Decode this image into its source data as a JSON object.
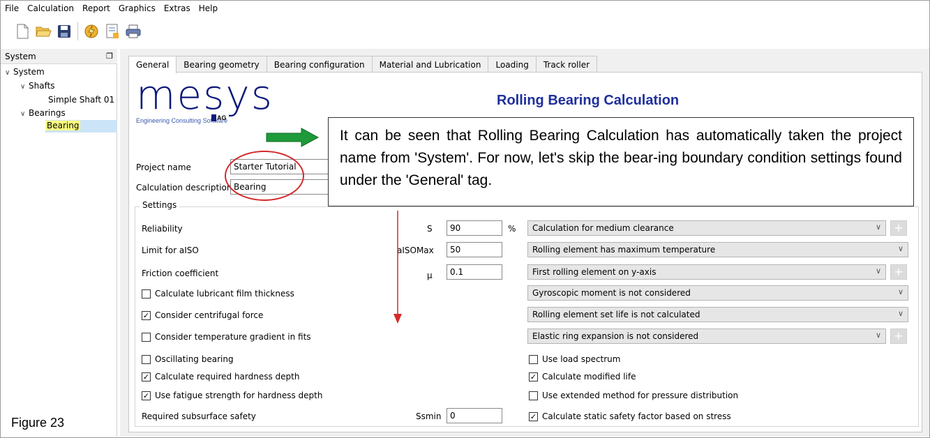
{
  "menu": [
    "File",
    "Calculation",
    "Report",
    "Graphics",
    "Extras",
    "Help"
  ],
  "toolbar": {
    "icons": [
      "new-file-icon",
      "open-folder-icon",
      "save-icon",
      "calculate-icon",
      "report-icon",
      "print-icon"
    ]
  },
  "left_panel": {
    "title": "System",
    "tree": {
      "root": "System",
      "shafts": "Shafts",
      "shaft_item": "Simple Shaft 01",
      "bearings": "Bearings",
      "bearing_item": "Bearing"
    }
  },
  "figure_label": "Figure 23",
  "tabs": [
    "General",
    "Bearing geometry",
    "Bearing configuration",
    "Material and Lubrication",
    "Loading",
    "Track roller"
  ],
  "logo": {
    "main": "mesys",
    "sub": "Engineering Consulting Software",
    "ag": "AG"
  },
  "calc_title": "Rolling Bearing Calculation",
  "project": {
    "name_label": "Project name",
    "name_value": "Starter Tutorial",
    "desc_label": "Calculation description",
    "desc_value": "Bearing"
  },
  "settings": {
    "legend": "Settings",
    "reliability": {
      "label": "Reliability",
      "symbol": "S",
      "value": "90",
      "unit": "%"
    },
    "limit_aiso": {
      "label": "Limit for aISO",
      "symbol": "aISOMax",
      "value": "50"
    },
    "friction": {
      "label": "Friction coefficient",
      "symbol": "μ",
      "value": "0.1"
    },
    "subsurface": {
      "label": "Required subsurface safety",
      "symbol": "Ssmin",
      "value": "0"
    },
    "checkboxes_left": [
      {
        "label": "Calculate lubricant film thickness",
        "checked": false
      },
      {
        "label": "Consider centrifugal force",
        "checked": true
      },
      {
        "label": "Consider temperature gradient in fits",
        "checked": false
      },
      {
        "label": "Oscillating bearing",
        "checked": false
      },
      {
        "label": "Calculate required hardness depth",
        "checked": true
      },
      {
        "label": "Use fatigue strength for hardness depth",
        "checked": true
      }
    ],
    "dropdowns": [
      "Calculation for medium clearance",
      "Rolling element has maximum temperature",
      "First rolling element on y-axis",
      "Gyroscopic moment is not considered",
      "Rolling element set life is not calculated",
      "Elastic ring expansion is not considered"
    ],
    "checkboxes_right": [
      {
        "label": "Use load spectrum",
        "checked": false
      },
      {
        "label": "Calculate modified life",
        "checked": true
      },
      {
        "label": "Use extended method for pressure distribution",
        "checked": false
      },
      {
        "label": "Calculate static safety factor based on stress",
        "checked": true
      }
    ]
  },
  "annotation": {
    "text": "It can be seen that Rolling Bearing Calculation has automatically taken the project name from 'System'. For now, let's skip the bear-ing boundary condition settings found under the 'General' tag."
  },
  "colors": {
    "accent": "#1f2f9c",
    "highlight": "#ffff80",
    "annotation_red": "#d42a2a",
    "arrow_green": "#1e9a3a"
  }
}
